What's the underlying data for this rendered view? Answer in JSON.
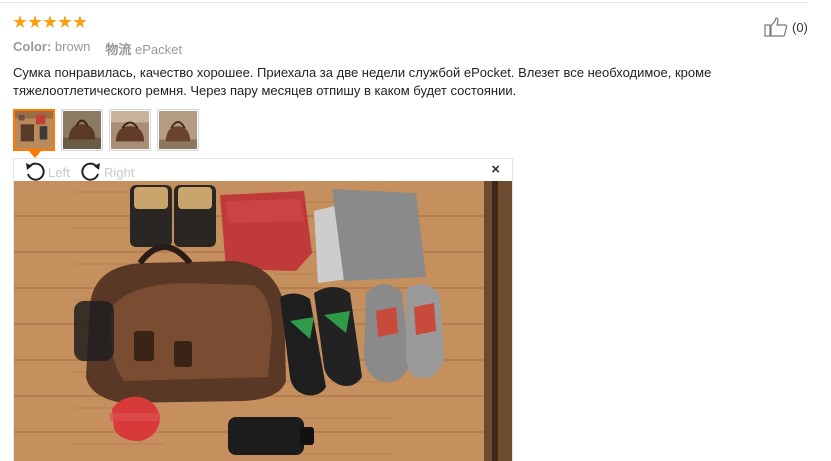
{
  "review": {
    "rating": 5,
    "color_label": "Color:",
    "color_value": "brown",
    "shipping_label": "物流",
    "shipping_value": "ePacket",
    "helpful_count": "(0)",
    "text": "Сумка понравилась, качество хорошее. Приехала за две недели службой ePocket. Влезет все необходимое, кроме тяжелоотлетического ремня. Через пару месяцев отпишу в каком будет состоянии."
  },
  "thumbnails": [
    {
      "name": "photo-1",
      "active": true
    },
    {
      "name": "photo-2",
      "active": false
    },
    {
      "name": "photo-3",
      "active": false
    },
    {
      "name": "photo-4",
      "active": false
    }
  ],
  "viewer": {
    "rotate_left_label": "Left",
    "rotate_right_label": "Right",
    "close_symbol": "×"
  },
  "colors": {
    "star": "#f6a10f",
    "active_thumb": "#ff7a00"
  },
  "icons": [
    "star-icon",
    "thumbs-up-icon",
    "rotate-left-icon",
    "rotate-right-icon",
    "close-icon"
  ]
}
